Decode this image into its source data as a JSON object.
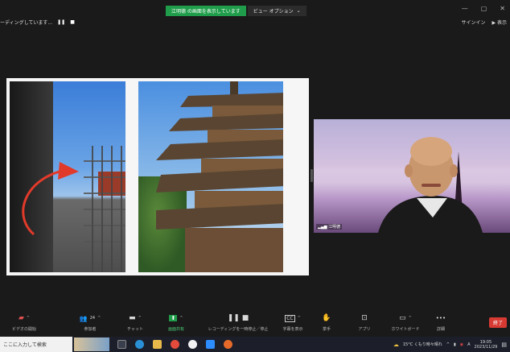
{
  "banner": {
    "sharing_text": "江明德 の画面を表示しています",
    "view_options_label": "ビュー オプション",
    "view_options_caret": "⌄"
  },
  "window_controls": {
    "minimize": "—",
    "maximize": "▢",
    "close": "✕"
  },
  "recording": {
    "status_text": "ーディングしています...",
    "pause_glyph": "❚❚",
    "stop_glyph": "■"
  },
  "top_right": {
    "signin_label": "サインイン",
    "display_label": "▶ 表示"
  },
  "speaker": {
    "name": "江明德"
  },
  "toolbar": {
    "items": [
      {
        "key": "video",
        "label": "ビデオの開始",
        "icon": "video-off-icon",
        "glyph": "▰",
        "caret": "^"
      },
      {
        "key": "participants",
        "label": "参加者",
        "icon": "participants-icon",
        "glyph": "👥",
        "count": "24",
        "caret": "^"
      },
      {
        "key": "chat",
        "label": "チャット",
        "icon": "chat-icon",
        "glyph": "▬",
        "caret": "^"
      },
      {
        "key": "share",
        "label": "画面共有",
        "icon": "share-screen-icon",
        "glyph": "⬆",
        "caret": "^"
      },
      {
        "key": "recording",
        "label": "レコーディングを一時停止／停止",
        "icon": "pause-stop-icon",
        "glyph": "❚❚ ■"
      },
      {
        "key": "captions",
        "label": "字幕を表示",
        "icon": "captions-icon",
        "glyph": "CC",
        "caret": "^"
      },
      {
        "key": "reactions",
        "label": "挙手",
        "icon": "raise-hand-icon",
        "glyph": "✋"
      },
      {
        "key": "apps",
        "label": "アプリ",
        "icon": "apps-icon",
        "glyph": "⊡"
      },
      {
        "key": "whiteboard",
        "label": "ホワイトボード",
        "icon": "whiteboard-icon",
        "glyph": "▭",
        "caret": "^"
      },
      {
        "key": "more",
        "label": "詳細",
        "icon": "more-icon",
        "glyph": "•••"
      }
    ],
    "end_label": "終了"
  },
  "taskbar": {
    "search_placeholder": "ここに入力して検索",
    "weather": "15°C くもり時々晴れ",
    "time": "19:05",
    "date": "2023/11/29",
    "chevron": "^",
    "apps": [
      {
        "icon": "task-view-icon",
        "color": "#3a3f4d"
      },
      {
        "icon": "edge-icon",
        "color": "#2a8fd6"
      },
      {
        "icon": "file-explorer-icon",
        "color": "#e8b84a"
      },
      {
        "icon": "chrome-icon",
        "color": "#e44b3c"
      },
      {
        "icon": "media-player-icon",
        "color": "#f2f2f2"
      },
      {
        "icon": "zoom-icon",
        "color": "#2d8cff"
      },
      {
        "icon": "app-icon",
        "color": "#e56a2a"
      }
    ]
  },
  "colors": {
    "green": "#1f9d4a",
    "end_red": "#d63a32",
    "background": "#1a1a1a"
  }
}
